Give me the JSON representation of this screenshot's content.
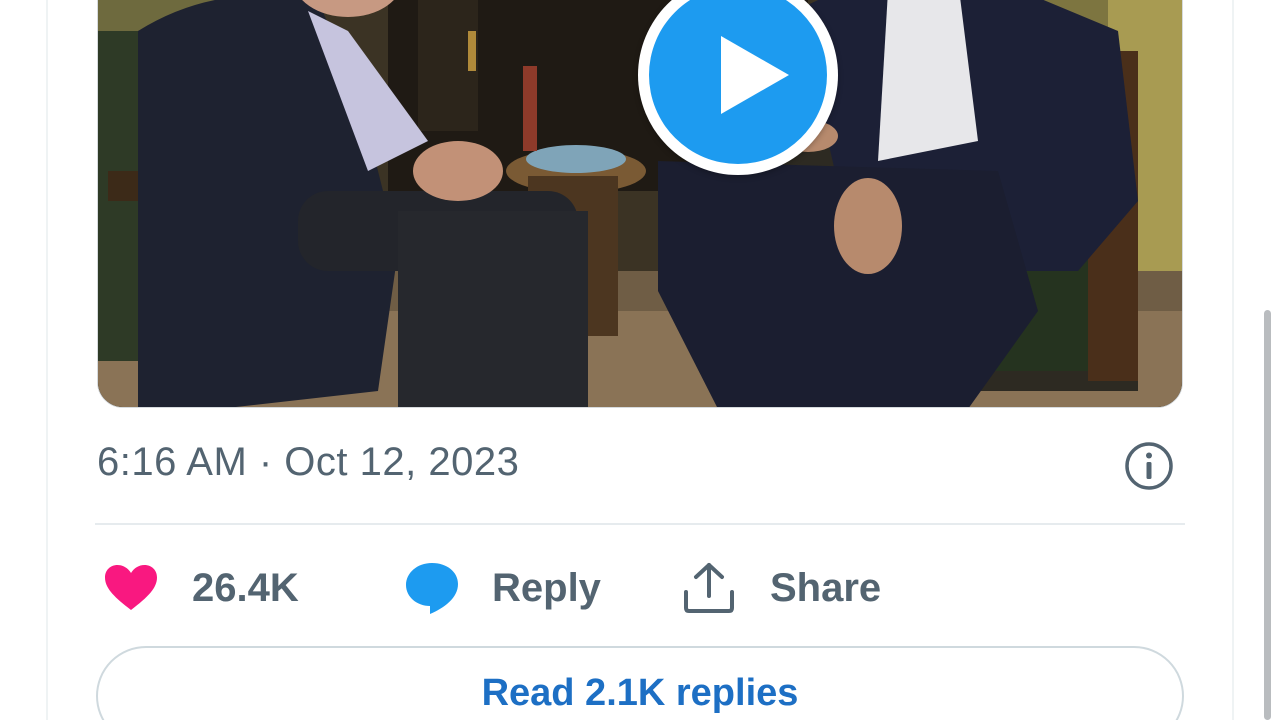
{
  "tweet": {
    "video": {
      "play_icon": "play-icon"
    },
    "timestamp": "6:16 AM · Oct 12, 2023",
    "info_icon": "info-icon",
    "actions": {
      "like": {
        "icon": "heart-icon",
        "count": "26.4K",
        "color": "#f91880"
      },
      "reply": {
        "icon": "speech-bubble-icon",
        "label": "Reply",
        "color": "#1d9bf0"
      },
      "share": {
        "icon": "share-upload-icon",
        "label": "Share"
      }
    },
    "read_replies": {
      "label": "Read 2.1K replies",
      "color": "#1d6fc4"
    }
  },
  "colors": {
    "accent": "#1d9bf0",
    "text_secondary": "#536471",
    "like": "#f91880",
    "border": "#cfd9de"
  }
}
